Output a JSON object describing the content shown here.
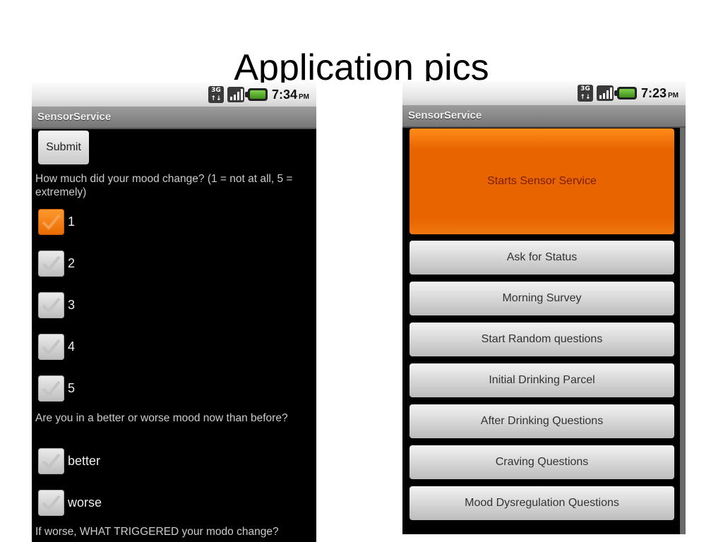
{
  "slide": {
    "title": "Application pics"
  },
  "left_phone": {
    "status_bar": {
      "network_icon": "3g-icon",
      "network_label": "3G",
      "signal_icon": "signal-bars-icon",
      "battery_icon": "battery-charging-icon",
      "time": "7:34",
      "ampm": "PM"
    },
    "app_title": "SensorService",
    "submit_label": "Submit",
    "question1": "How much did your mood change? (1 = not at all, 5 = extremely)",
    "scale_options": [
      {
        "label": "1",
        "checked": true
      },
      {
        "label": "2",
        "checked": false
      },
      {
        "label": "3",
        "checked": false
      },
      {
        "label": "4",
        "checked": false
      },
      {
        "label": "5",
        "checked": false
      }
    ],
    "question2": "Are you in a better or worse mood now than before?",
    "mood_options": [
      {
        "label": "better",
        "checked": false
      },
      {
        "label": "worse",
        "checked": false
      }
    ],
    "question3": "If worse, WHAT TRIGGERED your modo change?",
    "accent_color": "#e86a00"
  },
  "right_phone": {
    "status_bar": {
      "network_icon": "3g-icon",
      "network_label": "3G",
      "signal_icon": "signal-bars-icon",
      "battery_icon": "battery-charging-icon",
      "time": "7:23",
      "ampm": "PM"
    },
    "app_title": "SensorService",
    "buttons": [
      {
        "label": "Starts Sensor Service",
        "highlighted": true
      },
      {
        "label": "Ask for Status"
      },
      {
        "label": "Morning Survey"
      },
      {
        "label": "Start Random questions"
      },
      {
        "label": "Initial Drinking Parcel"
      },
      {
        "label": "After Drinking Questions"
      },
      {
        "label": "Craving Questions"
      },
      {
        "label": "Mood Dysregulation Questions"
      }
    ],
    "accent_color": "#e86400"
  }
}
